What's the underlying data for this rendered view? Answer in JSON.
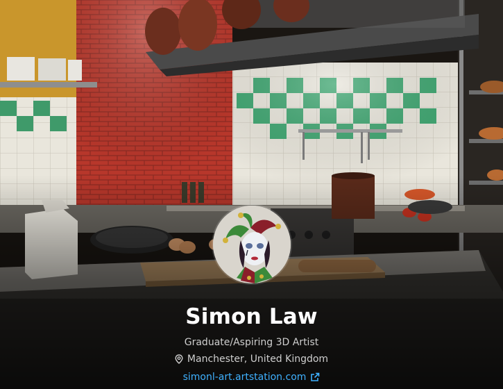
{
  "profile": {
    "name": "Simon Law",
    "headline": "Graduate/Aspiring 3D Artist",
    "location": "Manchester, United Kingdom",
    "website": "simonl-art.artstation.com"
  },
  "icons": {
    "location": "map-pin-icon",
    "website": "external-link-icon"
  },
  "colors": {
    "name": "#ffffff",
    "secondary_text": "#cfcfcf",
    "link": "#3fb1ff"
  }
}
